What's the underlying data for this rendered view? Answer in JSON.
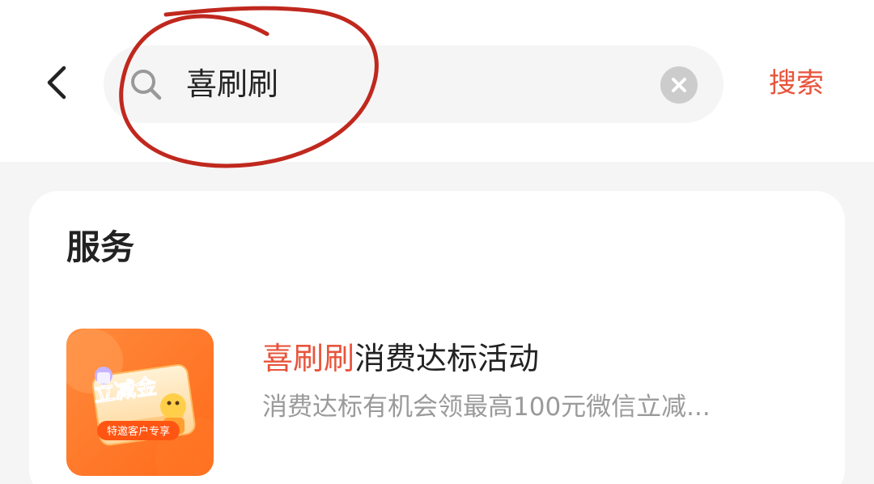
{
  "header": {
    "back_icon": "chevron-left-icon",
    "search_icon": "search-icon",
    "search_value": "喜刷刷",
    "clear_icon": "clear-circle-icon",
    "search_button_label": "搜索"
  },
  "results": {
    "section_title": "服务",
    "items": [
      {
        "title_highlight": "喜刷刷",
        "title_rest": "消费达标活动",
        "description": "消费达标有机会领最高100元微信立减...",
        "thumbnail": {
          "badge_text": "立减金",
          "ribbon_text": "特邀客户专享"
        }
      }
    ]
  },
  "colors": {
    "accent": "#e8543b",
    "annotation": "#c0281e",
    "page_bg": "#f5f5f5"
  }
}
